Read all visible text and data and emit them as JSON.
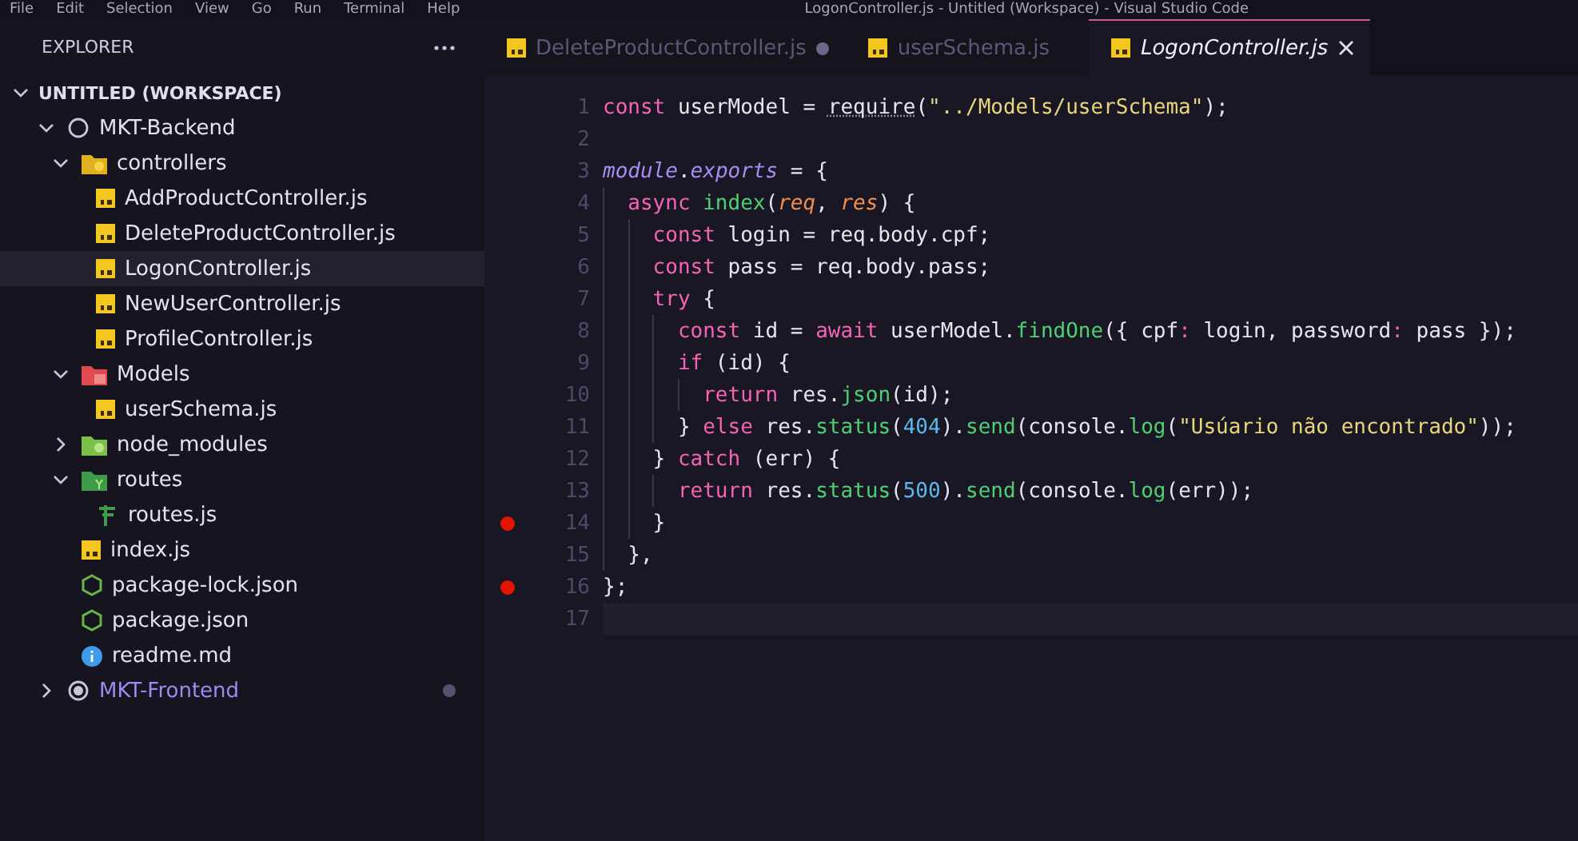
{
  "menu_bar": {
    "items": [
      "File",
      "Edit",
      "Selection",
      "View",
      "Go",
      "Run",
      "Terminal",
      "Help"
    ],
    "title": "LogonController.js - Untitled (Workspace) - Visual Studio Code"
  },
  "sidebar": {
    "title": "EXPLORER",
    "workspace": {
      "label": "UNTITLED (WORKSPACE)",
      "expanded": true,
      "items": [
        {
          "label": "MKT-Backend",
          "kind": "root",
          "expanded": true,
          "selected": false,
          "modified": false,
          "children": [
            {
              "label": "controllers",
              "kind": "folder-controllers",
              "expanded": true,
              "selected": false,
              "children": [
                {
                  "label": "AddProductController.js",
                  "kind": "js",
                  "selected": false
                },
                {
                  "label": "DeleteProductController.js",
                  "kind": "js",
                  "selected": false
                },
                {
                  "label": "LogonController.js",
                  "kind": "js",
                  "selected": true
                },
                {
                  "label": "NewUserController.js",
                  "kind": "js",
                  "selected": false
                },
                {
                  "label": "ProfileController.js",
                  "kind": "js",
                  "selected": false
                }
              ]
            },
            {
              "label": "Models",
              "kind": "folder-models",
              "expanded": true,
              "selected": false,
              "children": [
                {
                  "label": "userSchema.js",
                  "kind": "js",
                  "selected": false
                }
              ]
            },
            {
              "label": "node_modules",
              "kind": "folder-node",
              "expanded": false,
              "selected": false
            },
            {
              "label": "routes",
              "kind": "folder-routes",
              "expanded": true,
              "selected": false,
              "children": [
                {
                  "label": "routes.js",
                  "kind": "routes",
                  "selected": false
                }
              ]
            },
            {
              "label": "index.js",
              "kind": "js",
              "selected": false
            },
            {
              "label": "package-lock.json",
              "kind": "json",
              "selected": false
            },
            {
              "label": "package.json",
              "kind": "json",
              "selected": false
            },
            {
              "label": "readme.md",
              "kind": "info",
              "selected": false
            }
          ]
        },
        {
          "label": "MKT-Frontend",
          "kind": "root",
          "expanded": false,
          "selected": false,
          "modified": true
        }
      ]
    }
  },
  "tabs": [
    {
      "label": "DeleteProductController.js",
      "selected": false,
      "dirty": true
    },
    {
      "label": "userSchema.js",
      "selected": false,
      "dirty": false
    },
    {
      "label": "LogonController.js",
      "selected": true,
      "dirty": false
    }
  ],
  "editor": {
    "lines": [
      {
        "number": "1",
        "breakpoint": false,
        "current": false,
        "tokens": [
          {
            "kind": "keyword",
            "text": "const"
          },
          {
            "kind": "plain",
            "text": " userModel = "
          },
          {
            "kind": "hinted",
            "text": "require"
          },
          {
            "kind": "plain",
            "text": "("
          },
          {
            "kind": "string",
            "text": "\"../Models/userSchema\""
          },
          {
            "kind": "plain",
            "text": ");"
          }
        ]
      },
      {
        "number": "2",
        "breakpoint": false,
        "current": false
      },
      {
        "number": "3",
        "breakpoint": false,
        "current": false,
        "tokens": [
          {
            "kind": "module",
            "text": "module"
          },
          {
            "kind": "plain",
            "text": "."
          },
          {
            "kind": "module",
            "text": "exports"
          },
          {
            "kind": "plain",
            "text": " = {"
          }
        ],
        "children": [
          {
            "number": "4",
            "breakpoint": false,
            "current": false,
            "tokens": [
              {
                "kind": "keyword",
                "text": "async"
              },
              {
                "kind": "function",
                "text": " index"
              },
              {
                "kind": "plain",
                "text": "("
              },
              {
                "kind": "param",
                "text": "req"
              },
              {
                "kind": "plain",
                "text": ", "
              },
              {
                "kind": "param",
                "text": "res"
              },
              {
                "kind": "plain",
                "text": ") {"
              }
            ],
            "children": [
              {
                "number": "5",
                "breakpoint": false,
                "current": false,
                "tokens": [
                  {
                    "kind": "keyword",
                    "text": "const"
                  },
                  {
                    "kind": "plain",
                    "text": " login = req.body.cpf;"
                  }
                ]
              },
              {
                "number": "6",
                "breakpoint": false,
                "current": false,
                "tokens": [
                  {
                    "kind": "keyword",
                    "text": "const"
                  },
                  {
                    "kind": "plain",
                    "text": " pass = req.body.pass;"
                  }
                ]
              },
              {
                "number": "7",
                "breakpoint": false,
                "current": false,
                "tokens": [
                  {
                    "kind": "keyword",
                    "text": "try"
                  },
                  {
                    "kind": "plain",
                    "text": " {"
                  }
                ],
                "children": [
                  {
                    "number": "8",
                    "breakpoint": false,
                    "current": false,
                    "tokens": [
                      {
                        "kind": "keyword",
                        "text": "const"
                      },
                      {
                        "kind": "plain",
                        "text": " id = "
                      },
                      {
                        "kind": "keyword",
                        "text": "await"
                      },
                      {
                        "kind": "plain",
                        "text": " userModel."
                      },
                      {
                        "kind": "function",
                        "text": "findOne"
                      },
                      {
                        "kind": "plain",
                        "text": "({ cpf"
                      },
                      {
                        "kind": "keyword",
                        "text": ":"
                      },
                      {
                        "kind": "plain",
                        "text": " login, password"
                      },
                      {
                        "kind": "keyword",
                        "text": ":"
                      },
                      {
                        "kind": "plain",
                        "text": " pass });"
                      }
                    ]
                  },
                  {
                    "number": "9",
                    "breakpoint": false,
                    "current": false,
                    "tokens": [
                      {
                        "kind": "keyword",
                        "text": "if"
                      },
                      {
                        "kind": "plain",
                        "text": " (id) {"
                      }
                    ],
                    "children": [
                      {
                        "number": "10",
                        "breakpoint": false,
                        "current": false,
                        "tokens": [
                          {
                            "kind": "keyword",
                            "text": "return"
                          },
                          {
                            "kind": "plain",
                            "text": " res."
                          },
                          {
                            "kind": "function",
                            "text": "json"
                          },
                          {
                            "kind": "plain",
                            "text": "(id);"
                          }
                        ]
                      }
                    ]
                  },
                  {
                    "number": "11",
                    "breakpoint": false,
                    "current": false,
                    "tokens": [
                      {
                        "kind": "plain",
                        "text": "} "
                      },
                      {
                        "kind": "keyword",
                        "text": "else"
                      },
                      {
                        "kind": "plain",
                        "text": " res."
                      },
                      {
                        "kind": "function",
                        "text": "status"
                      },
                      {
                        "kind": "plain",
                        "text": "("
                      },
                      {
                        "kind": "number",
                        "text": "404"
                      },
                      {
                        "kind": "plain",
                        "text": ")."
                      },
                      {
                        "kind": "function",
                        "text": "send"
                      },
                      {
                        "kind": "plain",
                        "text": "(console."
                      },
                      {
                        "kind": "function",
                        "text": "log"
                      },
                      {
                        "kind": "plain",
                        "text": "("
                      },
                      {
                        "kind": "string",
                        "text": "\"Usúario não encontrado\""
                      },
                      {
                        "kind": "plain",
                        "text": "));"
                      }
                    ]
                  }
                ]
              },
              {
                "number": "12",
                "breakpoint": false,
                "current": false,
                "tokens": [
                  {
                    "kind": "plain",
                    "text": "} "
                  },
                  {
                    "kind": "keyword",
                    "text": "catch"
                  },
                  {
                    "kind": "plain",
                    "text": " (err) {"
                  }
                ],
                "children": [
                  {
                    "number": "13",
                    "breakpoint": false,
                    "current": false,
                    "tokens": [
                      {
                        "kind": "keyword",
                        "text": "return"
                      },
                      {
                        "kind": "plain",
                        "text": " res."
                      },
                      {
                        "kind": "function",
                        "text": "status"
                      },
                      {
                        "kind": "plain",
                        "text": "("
                      },
                      {
                        "kind": "number",
                        "text": "500"
                      },
                      {
                        "kind": "plain",
                        "text": ")."
                      },
                      {
                        "kind": "function",
                        "text": "send"
                      },
                      {
                        "kind": "plain",
                        "text": "(console."
                      },
                      {
                        "kind": "function",
                        "text": "log"
                      },
                      {
                        "kind": "plain",
                        "text": "(err));"
                      }
                    ]
                  }
                ]
              },
              {
                "number": "14",
                "breakpoint": true,
                "current": false,
                "tokens": [
                  {
                    "kind": "plain",
                    "text": "}"
                  }
                ]
              }
            ]
          },
          {
            "number": "15",
            "breakpoint": false,
            "current": false,
            "tokens": [
              {
                "kind": "plain",
                "text": "},"
              }
            ]
          }
        ]
      },
      {
        "number": "16",
        "breakpoint": true,
        "current": false,
        "tokens": [
          {
            "kind": "plain",
            "text": "};"
          }
        ]
      },
      {
        "number": "17",
        "breakpoint": false,
        "current": true
      }
    ]
  }
}
